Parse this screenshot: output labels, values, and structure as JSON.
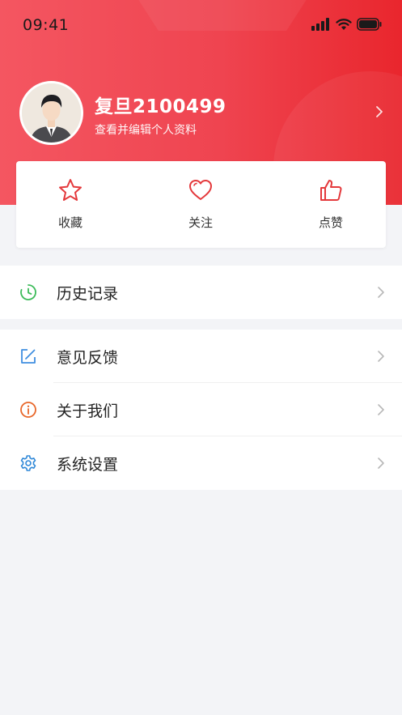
{
  "status_bar": {
    "time": "09:41"
  },
  "profile": {
    "username": "复旦2100499",
    "subtitle": "查看并编辑个人资料"
  },
  "stats": [
    {
      "label": "收藏",
      "icon": "star-icon"
    },
    {
      "label": "关注",
      "icon": "heart-icon"
    },
    {
      "label": "点赞",
      "icon": "thumbs-up-icon"
    }
  ],
  "menu": {
    "group1": [
      {
        "label": "历史记录",
        "icon": "clock-icon"
      }
    ],
    "group2": [
      {
        "label": "意见反馈",
        "icon": "edit-icon"
      },
      {
        "label": "关于我们",
        "icon": "info-icon"
      },
      {
        "label": "系统设置",
        "icon": "gear-icon"
      }
    ]
  },
  "colors": {
    "brand_red": "#ef4450",
    "icon_red": "#e4393c",
    "history_green": "#3dbb5a",
    "feedback_blue": "#3f8ee0",
    "about_orange": "#e8672a",
    "settings_blue": "#2f88d8",
    "background": "#f3f4f7"
  }
}
